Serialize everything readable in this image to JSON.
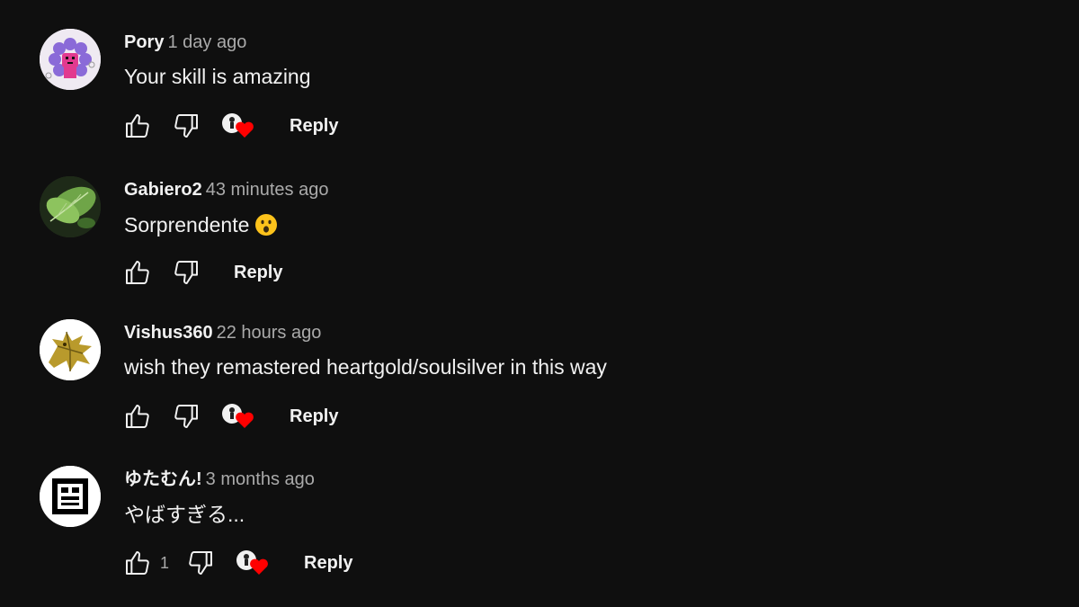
{
  "colors": {
    "background": "#0f0f0f",
    "text_primary": "#f1f1f1",
    "text_secondary": "#aaaaaa",
    "heart": "#ff0000"
  },
  "comments": [
    {
      "author": "Pory",
      "time": "1 day ago",
      "text": "Your skill is amazing",
      "like_count": "",
      "creator_heart": true,
      "reply_label": "Reply",
      "avatar_icon": "pink-creature-avatar"
    },
    {
      "author": "Gabiero2",
      "time": "43 minutes ago",
      "text": "Sorprendente",
      "emoji_icon": "surprised-face-icon",
      "like_count": "",
      "creator_heart": false,
      "reply_label": "Reply",
      "avatar_icon": "leaf-avatar"
    },
    {
      "author": "Vishus360",
      "time": "22 hours ago",
      "text": "wish they remastered heartgold/soulsilver in this way",
      "like_count": "",
      "creator_heart": true,
      "reply_label": "Reply",
      "avatar_icon": "golden-dragon-avatar"
    },
    {
      "author": "ゆたむん!",
      "time": "3 months ago",
      "text": "やばすぎる...",
      "like_count": "1",
      "creator_heart": true,
      "reply_label": "Reply",
      "avatar_icon": "pixel-face-avatar"
    }
  ]
}
